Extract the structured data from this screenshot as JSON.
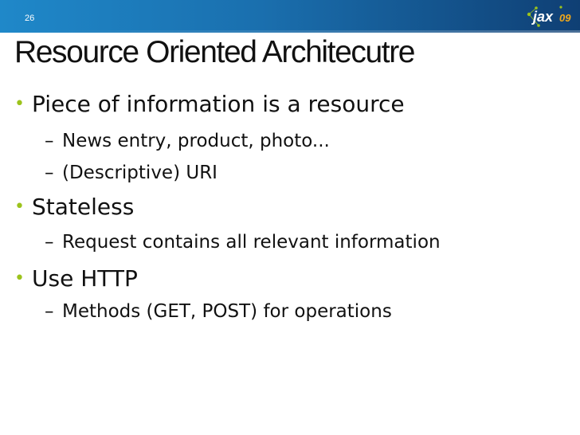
{
  "slide": {
    "page_number": "26",
    "title": "Resource Oriented Architecutre",
    "logo_text": "jax",
    "logo_suffix": "09",
    "bullet_char": "•",
    "dash_char": "–",
    "bullets": [
      {
        "text": "Piece of information is a resource",
        "sub": [
          "News entry, product, photo...",
          "(Descriptive) URI"
        ]
      },
      {
        "text": "Stateless",
        "sub": [
          "Request contains all relevant information"
        ]
      },
      {
        "text": "Use HTTP",
        "sub": [
          "Methods (GET, POST) for operations"
        ]
      }
    ],
    "colors": {
      "bar_left": "#1f88c9",
      "bar_right": "#0f3f74",
      "bullet": "#9cc31c",
      "logo_accent": "#f0a81a"
    }
  }
}
